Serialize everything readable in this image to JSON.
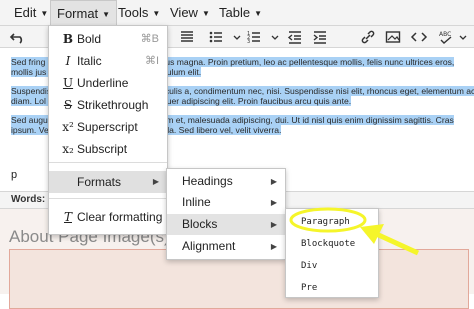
{
  "menubar": {
    "edit": "Edit",
    "format": "Format",
    "tools": "Tools",
    "view": "View",
    "table": "Table"
  },
  "editor": {
    "para1": [
      "Sed fring",
      "mollis jus"
    ],
    "para1_tail": [
      "sellus magna. Proin pretium, leo ac pellentesque mollis, felis nunc ultrices eros,",
      "stibulum elit."
    ],
    "para2": [
      "Suspendis",
      "diam. Lol"
    ],
    "para2_tail": [
      "iaculis a, condimentum nec, nisi. Suspendisse nisi elit, rhoncus eget, elementum ac, ullamcorper",
      "ctetuer adipiscing elit. Proin faucibus arcu quis ante."
    ],
    "para3": [
      "Sed augu",
      "ipsum. Ve"
    ],
    "para3_tail": [
      "ulum et, malesuada adipiscing, dui. Ut id nisl quis enim dignissim sagittis. Cras",
      "igula. Sed libero vel, velit viverra."
    ],
    "cursor_text": "p"
  },
  "statusbar": {
    "words": "Words: 8"
  },
  "page_below": {
    "title": "About Page Image(s)"
  },
  "format_menu": {
    "items": [
      {
        "icon": "B",
        "label": "Bold",
        "shortcut": "⌘B"
      },
      {
        "icon": "I",
        "label": "Italic",
        "shortcut": "⌘I"
      },
      {
        "icon": "U",
        "label": "Underline",
        "shortcut": ""
      },
      {
        "icon": "S",
        "label": "Strikethrough",
        "shortcut": ""
      },
      {
        "icon": "x²",
        "label": "Superscript",
        "shortcut": ""
      },
      {
        "icon": "x₂",
        "label": "Subscript",
        "shortcut": ""
      }
    ],
    "formats": "Formats",
    "clear": "Clear formatting"
  },
  "formats_submenu": [
    "Headings",
    "Inline",
    "Blocks",
    "Alignment"
  ],
  "blocks_submenu": [
    "Paragraph",
    "Blockquote",
    "Div",
    "Pre"
  ],
  "colors": {
    "selection": "#a9d1f5",
    "annotation": "#f5f52a"
  }
}
